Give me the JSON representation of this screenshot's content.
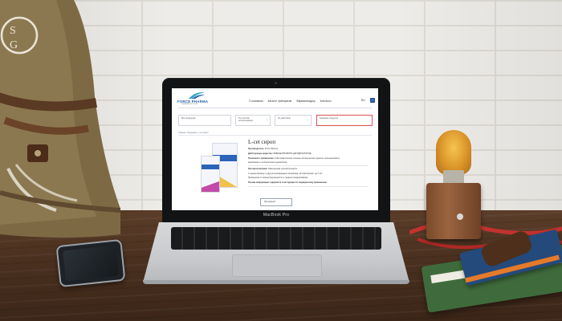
{
  "laptop": {
    "model_label": "MacBook Pro"
  },
  "site": {
    "logo": {
      "name": "FORCE PHARMA",
      "subtitle": "PHARMACEUTICAL"
    },
    "nav": {
      "items": [
        "О компании",
        "Каталог препаратов",
        "Фармаконадзор",
        "Контакты"
      ],
      "language": "RU"
    },
    "facebook_label": "f",
    "filters": [
      {
        "label": "Все продукции",
        "chevron": ""
      },
      {
        "label": "По способу использования",
        "chevron": "⌄"
      },
      {
        "label": "По действию",
        "chevron": "⌄"
      },
      {
        "label": "Название продукта",
        "chevron": ""
      }
    ],
    "breadcrumbs": "Главная / Продукция / L-cet сироп",
    "product": {
      "title": "L-cet сироп",
      "lines": [
        {
          "label": "Производитель:",
          "text": " Force Pharma"
        },
        {
          "label": "Действующее вещество:",
          "text": " ЛЕВОЦЕТИРИЗИНА ДИГИДРОХЛОРИД"
        },
        {
          "label": "Показания к применению:",
          "text": " Симптоматическое лечение аллергического ринита и конъюнктивита,"
        },
        {
          "label": "",
          "text": "крапивницы и аллергических дерматозов."
        },
        {
          "label": "Противопоказания:",
          "text": " Повышенная чувствительность"
        },
        {
          "label": "",
          "text": "к левоцетиризину, к другим производным пиперазина, детский возраст до 2 лет"
        },
        {
          "label": "",
          "text": "Применение в период беременности и грудного вскармливания."
        },
        {
          "label": "",
          "text": "Полная информация содержится в инструкции по медицинскому применению."
        }
      ],
      "button_label": "Инструкция"
    }
  }
}
